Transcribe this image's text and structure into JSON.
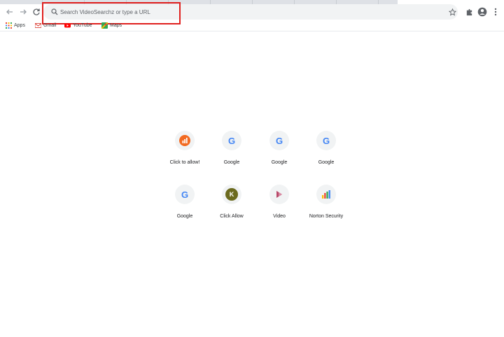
{
  "omnibox": {
    "placeholder": "Search VideoSearchz or type a URL"
  },
  "bookmarks": [
    {
      "label": "Apps",
      "icon": "apps-grid-icon"
    },
    {
      "label": "Gmail",
      "icon": "gmail-icon"
    },
    {
      "label": "YouTube",
      "icon": "youtube-icon"
    },
    {
      "label": "Maps",
      "icon": "maps-icon"
    }
  ],
  "shortcuts": [
    {
      "label": "Click to allow!",
      "icon": "orange-chart-icon"
    },
    {
      "label": "Google",
      "icon": "google-g-icon"
    },
    {
      "label": "Google",
      "icon": "google-g-icon"
    },
    {
      "label": "Google",
      "icon": "google-g-icon"
    },
    {
      "label": "Google",
      "icon": "google-g-icon"
    },
    {
      "label": "Click Allow",
      "icon": "letter-k-icon",
      "letter": "K",
      "color": "#6b6a1e"
    },
    {
      "label": "Video",
      "icon": "video-icon"
    },
    {
      "label": "Norton Security",
      "icon": "bar-chart-icon"
    }
  ],
  "colors": {
    "highlight": "#e0201e",
    "omnibox_bg": "#f1f3f4",
    "tile_bg": "#f1f3f4"
  }
}
